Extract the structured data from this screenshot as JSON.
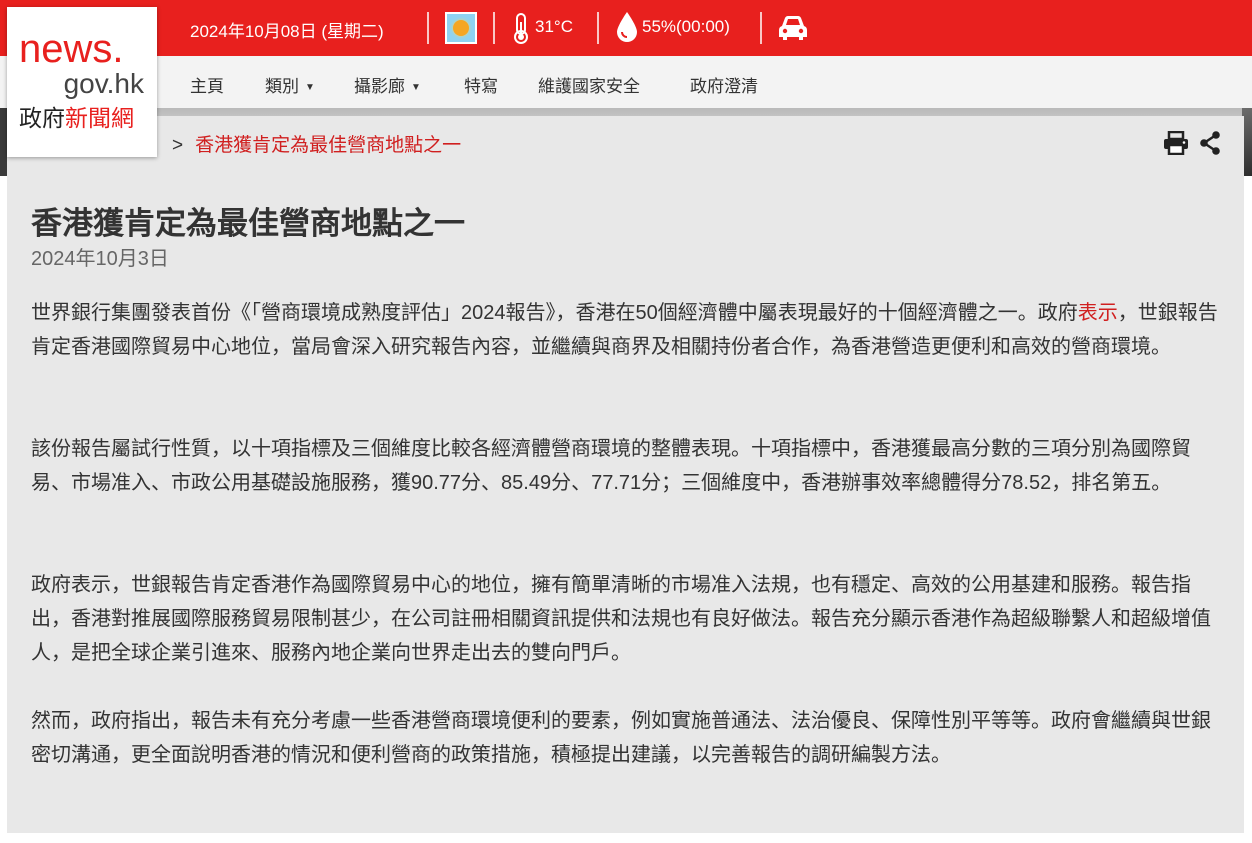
{
  "header": {
    "date": "2024年10月08日 (星期二)",
    "temperature": "31°C",
    "humidity": "55%(00:00)",
    "icons": [
      "weather-sunny-icon",
      "thermometer-icon",
      "humidity-drop-icon",
      "traffic-car-icon"
    ]
  },
  "logo": {
    "line1": "news.",
    "line2": "gov.hk",
    "line3_black": "政府",
    "line3_red": "新聞網"
  },
  "nav": {
    "home": "主頁",
    "category": "類別",
    "gallery": "攝影廊",
    "feature": "特寫",
    "security": "維護國家安全",
    "clarification": "政府澄清"
  },
  "breadcrumb": {
    "separator": ">",
    "current": "香港獲肯定為最佳營商地點之一"
  },
  "article": {
    "title": "香港獲肯定為最佳營商地點之一",
    "date": "2024年10月3日",
    "p1a": "世界銀行集團發表首份《「營商環境成熟度評估」2024報告》，香港在50個經濟體中屬表現最好的十個經濟體之一。政府",
    "p1_link": "表示",
    "p1b": "，世銀報告肯定香港國際貿易中心地位，當局會深入研究報告內容，並繼續與商界及相關持份者合作，為香港營造更便利和高效的營商環境。",
    "p2": "該份報告屬試行性質，以十項指標及三個維度比較各經濟體營商環境的整體表現。十項指標中，香港獲最高分數的三項分別為國際貿易、市場准入、市政公用基礎設施服務，獲90.77分、85.49分、77.71分；三個維度中，香港辦事效率總體得分78.52，排名第五。",
    "p3": "政府表示，世銀報告肯定香港作為國際貿易中心的地位，擁有簡單清晰的市場准入法規，也有穩定、高效的公用基建和服務。報告指出，香港對推展國際服務貿易限制甚少，在公司註冊相關資訊提供和法規也有良好做法。報告充分顯示香港作為超級聯繫人和超級增值人，是把全球企業引進來、服務內地企業向世界走出去的雙向門戶。",
    "p4": "然而，政府指出，報告未有充分考慮一些香港營商環境便利的要素，例如實施普通法、法治優良、保障性別平等等。政府會繼續與世銀密切溝通，更全面說明香港的情況和便利營商的政策措施，積極提出建議，以完善報告的調研編製方法。"
  },
  "colors": {
    "brand_red": "#e8201e",
    "link_red": "#d01f1f",
    "content_bg": "#e8e8e8",
    "nav_bg": "#f3f3f3"
  }
}
